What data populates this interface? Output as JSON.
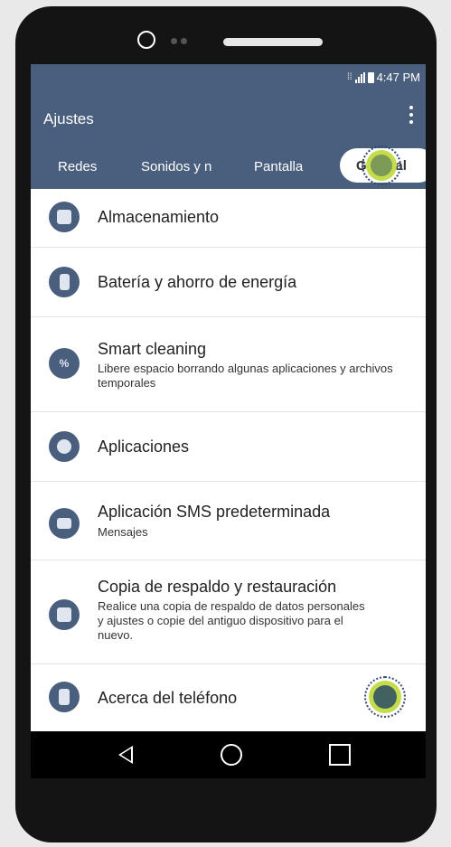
{
  "status": {
    "time": "4:47 PM"
  },
  "appbar": {
    "title": "Ajustes"
  },
  "tabs": [
    {
      "label": "Redes"
    },
    {
      "label": "Sonidos y n"
    },
    {
      "label": "Pantalla"
    },
    {
      "label": "General"
    }
  ],
  "settings": {
    "items": [
      {
        "title": "Almacenamiento",
        "icon": "storage-icon"
      },
      {
        "title": "Batería y ahorro de energía",
        "icon": "battery-icon"
      },
      {
        "title": "Smart cleaning",
        "subtitle": "Libere espacio borrando algunas aplicaciones y archivos temporales",
        "icon": "smart-cleaning-icon"
      },
      {
        "title": "Aplicaciones",
        "icon": "apps-icon"
      },
      {
        "title": "Aplicación SMS predeterminada",
        "subtitle": "Mensajes",
        "icon": "message-icon"
      },
      {
        "title": "Copia de respaldo y restauración",
        "subtitle": "Realice una copia de respaldo de datos personales y ajustes o copie del antiguo dispositivo para el nuevo.",
        "icon": "backup-icon"
      },
      {
        "title": "Acerca del teléfono",
        "icon": "phone-info-icon"
      }
    ]
  },
  "colors": {
    "header": "#4a5f7e",
    "tap_indicator": "#c5dd4a"
  }
}
